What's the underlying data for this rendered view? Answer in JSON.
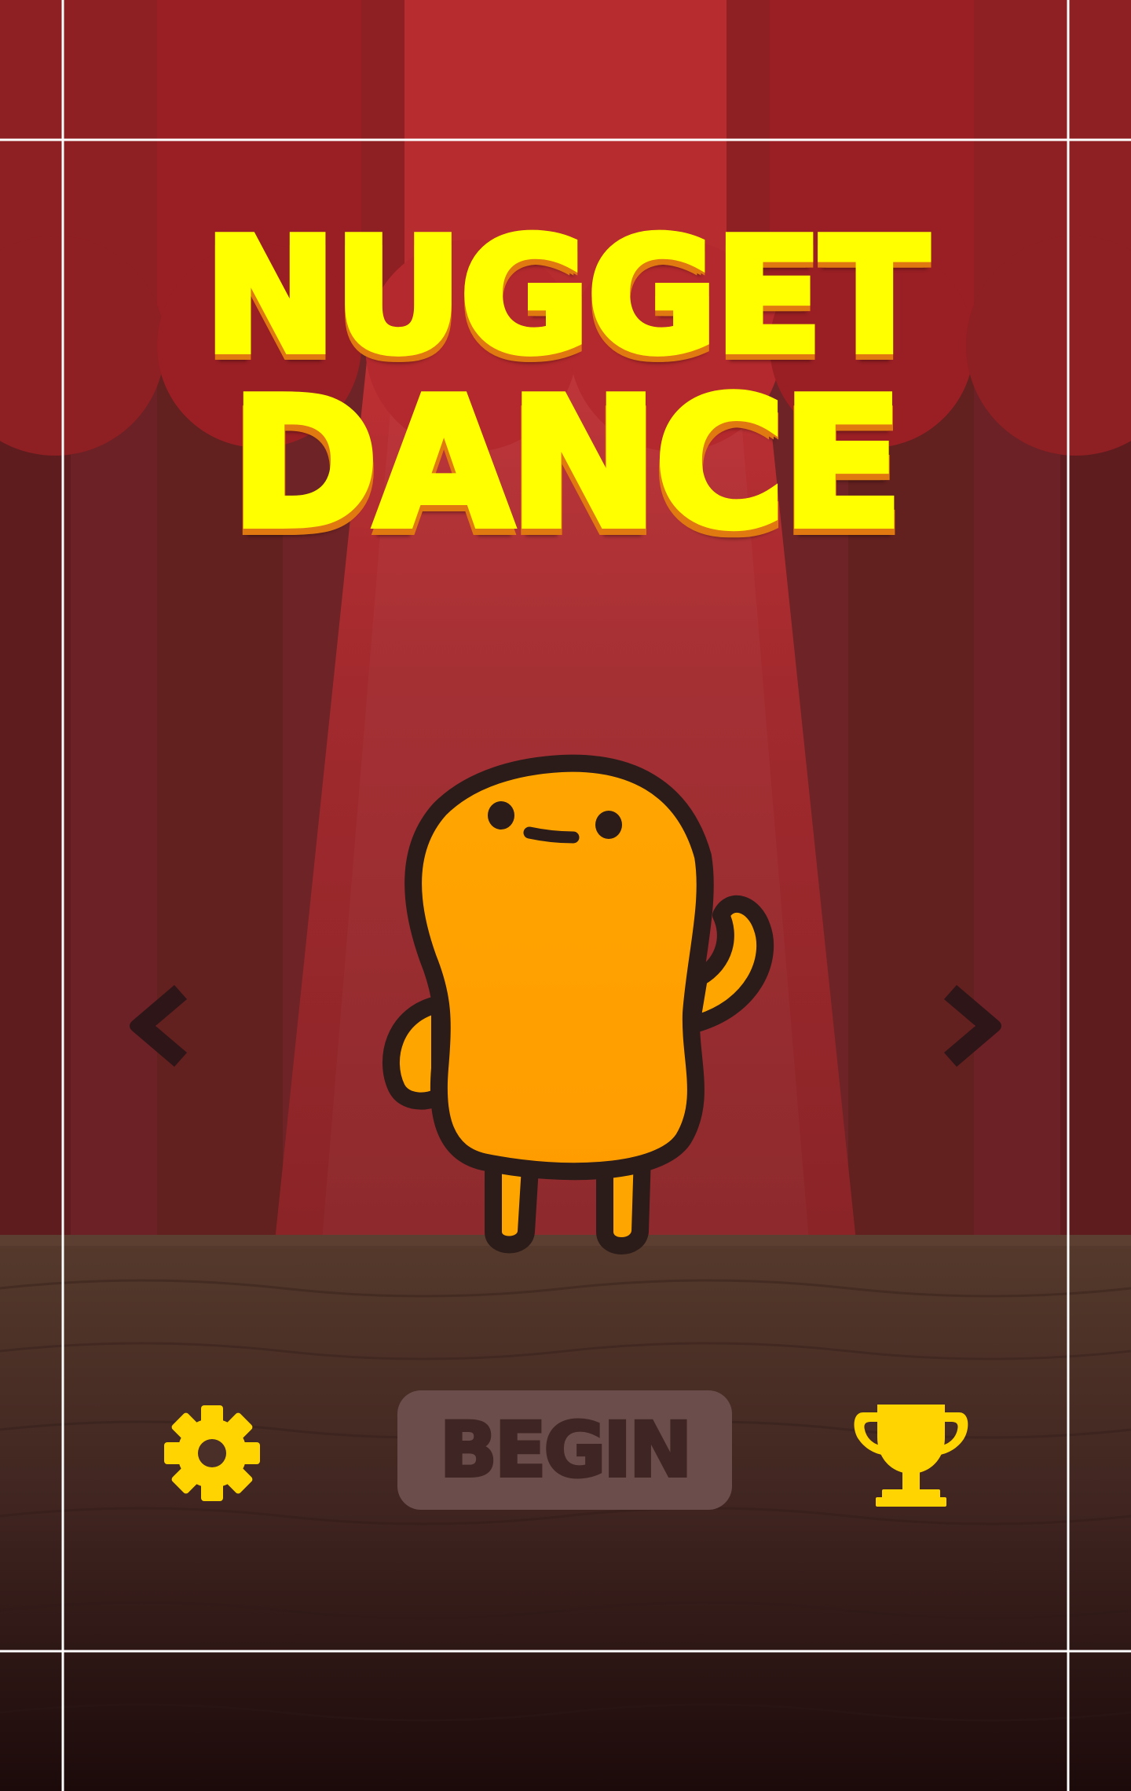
{
  "title": {
    "line1": "NUGGET",
    "line2": "DANCE"
  },
  "menu": {
    "begin_label": "BEGIN"
  },
  "icons": {
    "settings": "gear-icon",
    "leaderboard": "trophy-icon",
    "previous": "chevron-left-icon",
    "next": "chevron-right-icon"
  },
  "colors": {
    "title_fill": "#ffff00",
    "title_shadow": "#e07a10",
    "accent_icons": "#ffd400",
    "character": "#ffa000",
    "curtain": "#8c1f22",
    "spotlight": "#d93538",
    "stage_floor": "#4e3229",
    "begin_button": "#6b4e4b"
  }
}
